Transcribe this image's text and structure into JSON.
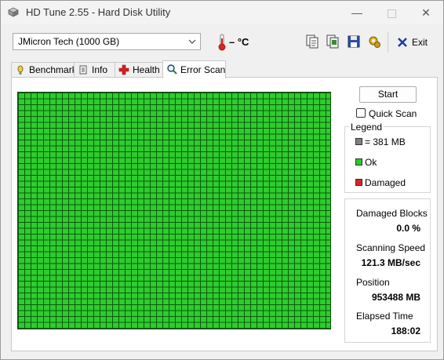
{
  "window": {
    "title": "HD Tune 2.55 - Hard Disk Utility"
  },
  "toolbar": {
    "drive": "JMicron Tech (1000 GB)",
    "temperature": "– °C",
    "exit_label": "Exit",
    "icons": [
      "copy-text-icon",
      "copy-screenshot-icon",
      "save-icon",
      "options-icon"
    ]
  },
  "tabs": [
    {
      "label": "Benchmark",
      "icon": "benchmark-icon",
      "active": false
    },
    {
      "label": "Info",
      "icon": "info-icon",
      "active": false
    },
    {
      "label": "Health",
      "icon": "health-icon",
      "active": false
    },
    {
      "label": "Error Scan",
      "icon": "error-scan-icon",
      "active": true
    }
  ],
  "scan": {
    "start_label": "Start",
    "quick_scan_label": "Quick Scan",
    "quick_scan_checked": false,
    "block_color_ok": "#2ecc2e"
  },
  "legend": {
    "title": "Legend",
    "block_size": "= 381 MB",
    "ok": "Ok",
    "damaged": "Damaged",
    "colors": {
      "block": "#808080",
      "ok": "#22cc22",
      "damaged": "#dd2222"
    }
  },
  "stats": {
    "damaged_blocks_label": "Damaged Blocks",
    "damaged_blocks_value": "0.0 %",
    "scanning_speed_label": "Scanning Speed",
    "scanning_speed_value": "121.3 MB/sec",
    "position_label": "Position",
    "position_value": "953488 MB",
    "elapsed_time_label": "Elapsed Time",
    "elapsed_time_value": "188:02"
  }
}
